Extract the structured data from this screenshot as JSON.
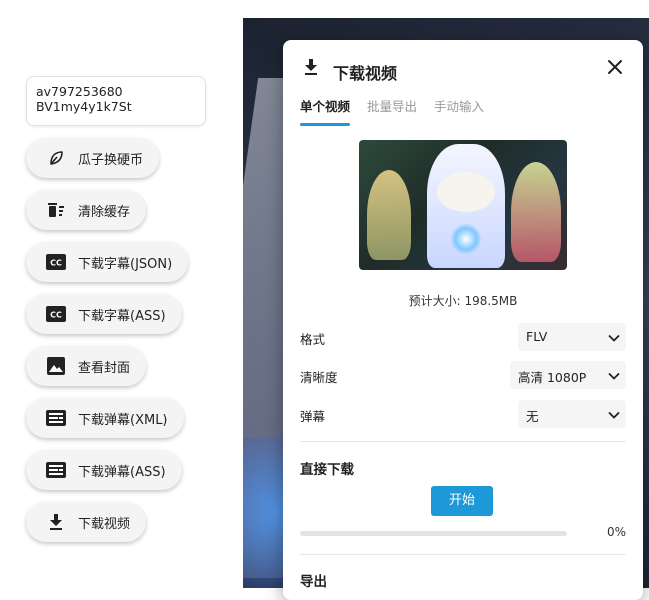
{
  "left_panel": {
    "id_box": {
      "av": "av797253680",
      "bv": "BV1my4y1k7St"
    },
    "buttons": [
      {
        "label": "瓜子换硬币",
        "icon": "leaf-icon"
      },
      {
        "label": "清除缓存",
        "icon": "trash-icon"
      },
      {
        "label": "下载字幕(JSON)",
        "icon": "closed-caption-icon"
      },
      {
        "label": "下载字幕(ASS)",
        "icon": "closed-caption-icon"
      },
      {
        "label": "查看封面",
        "icon": "image-icon"
      },
      {
        "label": "下载弹幕(XML)",
        "icon": "danmaku-icon"
      },
      {
        "label": "下载弹幕(ASS)",
        "icon": "danmaku-icon"
      },
      {
        "label": "下载视频",
        "icon": "download-icon"
      }
    ]
  },
  "dialog": {
    "title": "下载视频",
    "tabs": [
      {
        "label": "单个视频",
        "active": true
      },
      {
        "label": "批量导出",
        "active": false
      },
      {
        "label": "手动输入",
        "active": false
      }
    ],
    "estimated_size": "预计大小: 198.5MB",
    "format": {
      "label": "格式",
      "value": "FLV"
    },
    "quality": {
      "label": "清晰度",
      "value": "高清 1080P"
    },
    "danmaku": {
      "label": "弹幕",
      "value": "无"
    },
    "direct_download": {
      "title": "直接下载",
      "start_label": "开始",
      "progress": 0,
      "progress_text": "0%"
    },
    "export": {
      "title": "导出"
    }
  },
  "colors": {
    "accent": "#1c99d6",
    "pill_bg": "#f4f4f4"
  }
}
